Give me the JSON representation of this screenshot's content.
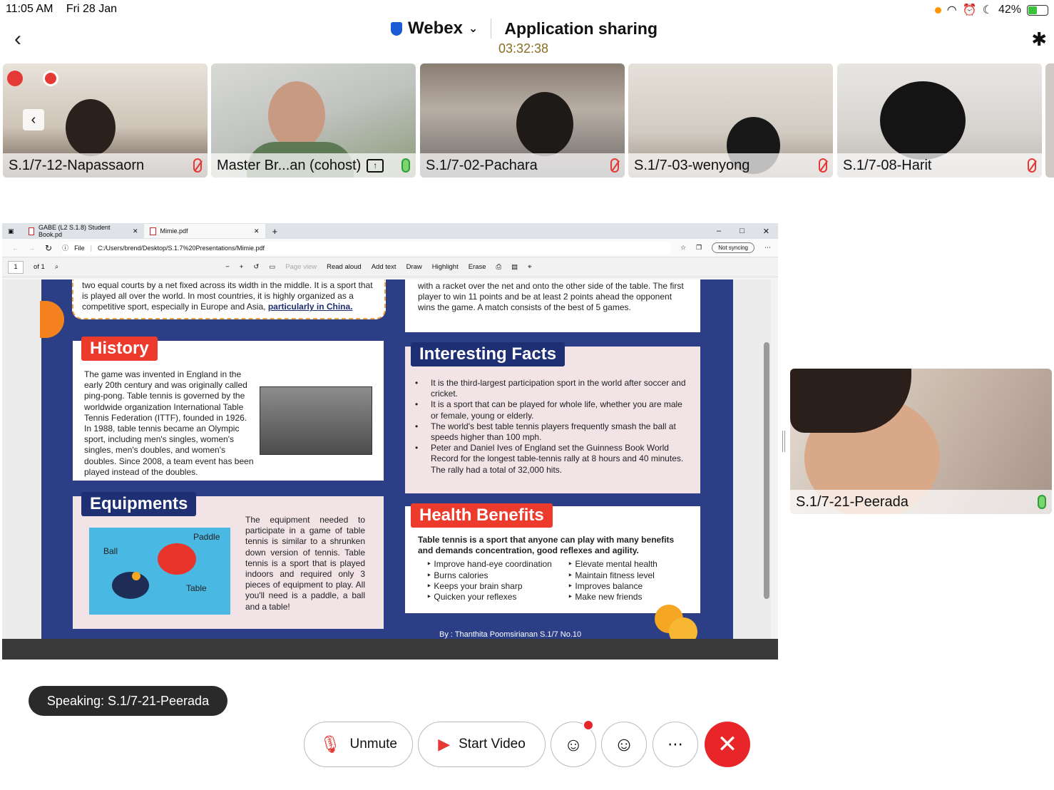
{
  "status_bar": {
    "time": "11:05 AM",
    "date": "Fri 28 Jan",
    "battery": "42%"
  },
  "header": {
    "app": "Webex",
    "title": "Application sharing",
    "timer": "03:32:38"
  },
  "participants": [
    {
      "name": "S.1/7-12-Napassaorn",
      "mic": "muted"
    },
    {
      "name": "Master Br...an (cohost)",
      "mic": "on"
    },
    {
      "name": "S.1/7-02-Pachara",
      "mic": "muted"
    },
    {
      "name": "S.1/7-03-wenyong",
      "mic": "muted"
    },
    {
      "name": "S.1/7-08-Harit",
      "mic": "muted"
    }
  ],
  "browser": {
    "tabs": [
      "GABE (L2 S.1.8) Student Book.pd",
      "Mimie.pdf"
    ],
    "url_prefix": "File",
    "url": "C:/Users/brend/Desktop/S.1.7%20Presentations/Mimie.pdf",
    "sync": "Not syncing",
    "page_num": "1",
    "page_of": "of 1",
    "tools": [
      "Page view",
      "Read aloud",
      "Add text",
      "Draw",
      "Highlight",
      "Erase"
    ]
  },
  "pdf": {
    "intro_left": "two equal courts by a net fixed across its width in the middle. It is a sport that is played all over the world. In most countries, it is highly organized as a competitive sport, especially in Europe and Asia,",
    "intro_left_link": "particularly in China.",
    "intro_right": "with a racket over the net and onto the other side of the table. The first player to win 11 points and be at least 2 points ahead the opponent wins the game. A match consists of the best of 5 games.",
    "history_title": "History",
    "history_text": "The game was invented in England in the early 20th century and was originally called ping-pong. Table tennis is governed by the worldwide organization International Table Tennis Federation (ITTF), founded in 1926. In 1988, table tennis became an Olympic sport, including men's singles, women's singles, men's doubles, and women's doubles. Since 2008, a team event has been played instead of the doubles.",
    "facts_title": "Interesting Facts",
    "facts": [
      "It is the third-largest participation sport in the world after soccer and cricket.",
      "It is a sport that can be played for whole life, whether you are male or female, young or elderly.",
      "The world's best table tennis players frequently smash the ball at speeds higher than 100 mph.",
      "Peter and Daniel Ives of England set the Guinness Book World Record for the longest table-tennis rally at 8 hours and 40 minutes. The rally had a total of 32,000 hits."
    ],
    "equip_title": "Equipments",
    "equip_labels": {
      "paddle": "Paddle",
      "ball": "Ball",
      "table": "Table"
    },
    "equip_text": "The equipment needed to participate in a game of table tennis is similar to a shrunken down version of tennis. Table tennis is a sport that is played indoors and required only 3 pieces of equipment to play. All you'll need is a paddle, a ball and a table!",
    "health_title": "Health Benefits",
    "health_intro": "Table tennis is a sport that anyone can play with many benefits and demands concentration, good reflexes and agility.",
    "health_left": [
      "Improve hand-eye coordination",
      "Burns calories",
      "Keeps your brain sharp",
      "Quicken your reflexes"
    ],
    "health_right": [
      "Elevate mental health",
      "Maintain fitness level",
      "Improves balance",
      "Make new friends"
    ],
    "byline": "By : Thanthita Poomsirianan S.1/7 No.10"
  },
  "self_view": {
    "name": "S.1/7-21-Peerada"
  },
  "speaking": "Speaking: S.1/7-21-Peerada",
  "controls": {
    "unmute": "Unmute",
    "start_video": "Start Video"
  }
}
